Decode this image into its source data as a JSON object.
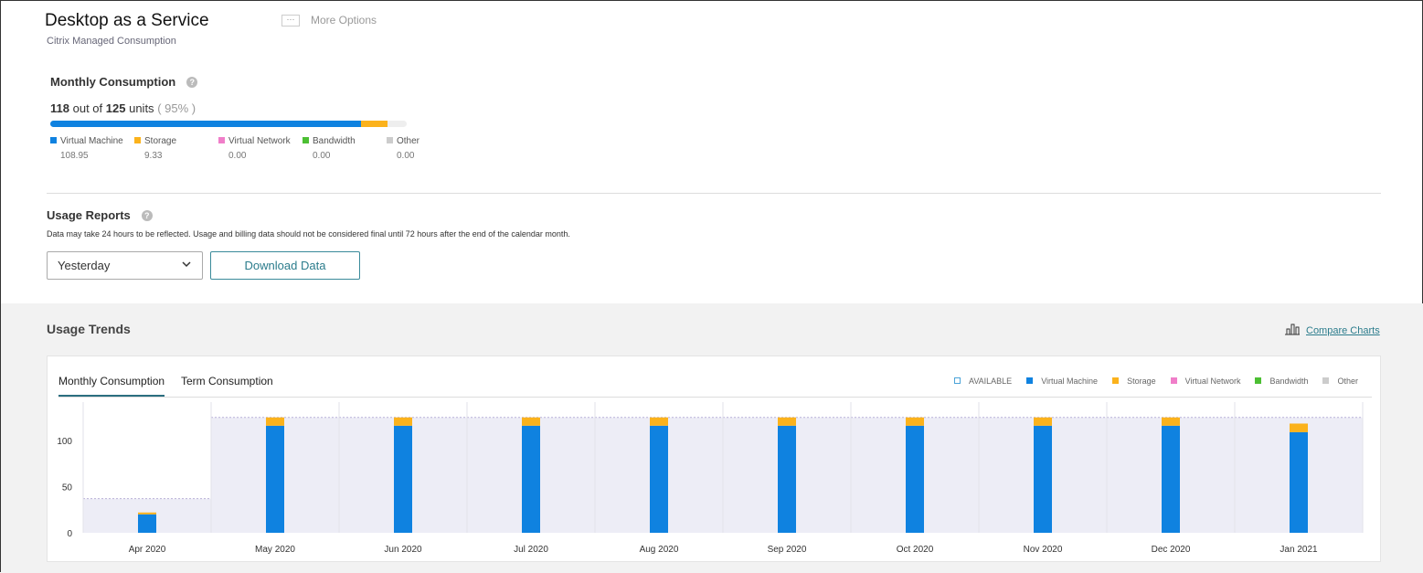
{
  "header": {
    "title": "Desktop as a Service",
    "subtitle": "Citrix Managed Consumption",
    "more_options": "More Options"
  },
  "monthly": {
    "heading": "Monthly Consumption",
    "used": "118",
    "out_of": "out of",
    "total": "125",
    "units": "units",
    "percent": "( 95% )",
    "used_fraction": 0.95,
    "items": [
      {
        "label": "Virtual Machine",
        "value": "108.95",
        "color": "#0f82e0"
      },
      {
        "label": "Storage",
        "value": "9.33",
        "color": "#fbb21c"
      },
      {
        "label": "Virtual Network",
        "value": "0.00",
        "color": "#f07ec9"
      },
      {
        "label": "Bandwidth",
        "value": "0.00",
        "color": "#4cbf33"
      },
      {
        "label": "Other",
        "value": "0.00",
        "color": "#cccccc"
      }
    ]
  },
  "reports": {
    "heading": "Usage Reports",
    "note": "Data may take 24 hours to be reflected. Usage and billing data should not be considered final until 72 hours after the end of the calendar month.",
    "range": "Yesterday",
    "download": "Download Data"
  },
  "trends": {
    "heading": "Usage Trends",
    "compare": "Compare Charts",
    "tabs": [
      "Monthly Consumption",
      "Term Consumption"
    ],
    "legend": [
      {
        "label": "AVAILABLE",
        "color": "#4aa3d8",
        "outline": true
      },
      {
        "label": "Virtual Machine",
        "color": "#0f82e0"
      },
      {
        "label": "Storage",
        "color": "#fbb21c"
      },
      {
        "label": "Virtual Network",
        "color": "#f07ec9"
      },
      {
        "label": "Bandwidth",
        "color": "#4cbf33"
      },
      {
        "label": "Other",
        "color": "#cccccc"
      }
    ]
  },
  "chart_data": {
    "type": "bar",
    "stacked": true,
    "categories": [
      "Apr 2020",
      "May 2020",
      "Jun 2020",
      "Jul 2020",
      "Aug 2020",
      "Sep 2020",
      "Oct 2020",
      "Nov 2020",
      "Dec 2020",
      "Jan 2021"
    ],
    "available": [
      37,
      125,
      125,
      125,
      125,
      125,
      125,
      125,
      125,
      125
    ],
    "series": [
      {
        "name": "Virtual Machine",
        "color": "#0f82e0",
        "values": [
          20,
          116,
          116,
          116,
          116,
          116,
          116,
          116,
          116,
          109
        ]
      },
      {
        "name": "Storage",
        "color": "#fbb21c",
        "values": [
          2,
          9,
          9,
          9,
          9,
          9,
          9,
          9,
          9,
          9.33
        ]
      }
    ],
    "yticks": [
      0,
      50,
      100
    ],
    "ylim": [
      0,
      130
    ]
  }
}
